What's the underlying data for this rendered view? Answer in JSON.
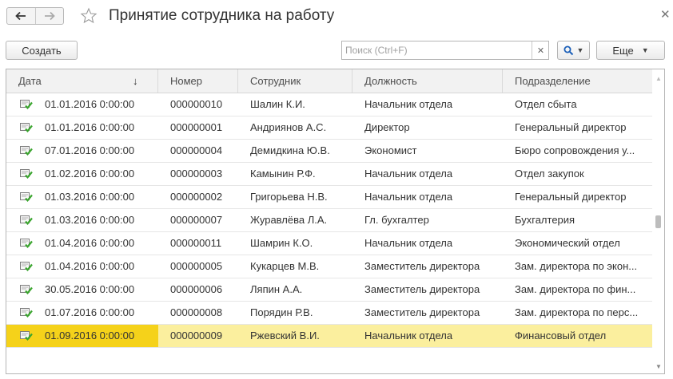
{
  "window": {
    "title": "Принятие сотрудника на работу"
  },
  "toolbar": {
    "create_label": "Создать",
    "search_placeholder": "Поиск (Ctrl+F)",
    "search_value": "",
    "more_label": "Еще"
  },
  "table": {
    "columns": [
      "Дата",
      "Номер",
      "Сотрудник",
      "Должность",
      "Подразделение"
    ],
    "sort_column": "Дата",
    "sort_direction": "descending",
    "selected_row_index": 10,
    "rows": [
      [
        "01.01.2016 0:00:00",
        "000000010",
        "Шалин К.И.",
        "Начальник отдела",
        "Отдел сбыта"
      ],
      [
        "01.01.2016 0:00:00",
        "000000001",
        "Андриянов А.С.",
        "Директор",
        "Генеральный директор"
      ],
      [
        "07.01.2016 0:00:00",
        "000000004",
        "Демидкина Ю.В.",
        "Экономист",
        "Бюро сопровождения у..."
      ],
      [
        "01.02.2016 0:00:00",
        "000000003",
        "Камынин Р.Ф.",
        "Начальник отдела",
        "Отдел закупок"
      ],
      [
        "01.03.2016 0:00:00",
        "000000002",
        "Григорьева Н.В.",
        "Начальник отдела",
        "Генеральный директор"
      ],
      [
        "01.03.2016 0:00:00",
        "000000007",
        "Журавлёва Л.А.",
        "Гл. бухгалтер",
        "Бухгалтерия"
      ],
      [
        "01.04.2016 0:00:00",
        "000000011",
        "Шамрин К.О.",
        "Начальник отдела",
        "Экономический отдел"
      ],
      [
        "01.04.2016 0:00:00",
        "000000005",
        "Кукарцев М.В.",
        "Заместитель директора",
        "Зам. директора по экон..."
      ],
      [
        "30.05.2016 0:00:00",
        "000000006",
        "Ляпин А.А.",
        "Заместитель директора",
        "Зам. директора по фин..."
      ],
      [
        "01.07.2016 0:00:00",
        "000000008",
        "Порядин Р.В.",
        "Заместитель директора",
        "Зам. директора по перс..."
      ],
      [
        "01.09.2016 0:00:00",
        "000000009",
        "Ржевский В.И.",
        "Начальник отдела",
        "Финансовый отдел"
      ]
    ]
  },
  "icons": {
    "back": "arrow-left-icon",
    "forward": "arrow-right-icon",
    "favorite": "star-icon",
    "close": "close-icon",
    "search": "search-icon",
    "row": "posted-document-icon"
  },
  "colors": {
    "selected_row": "#fbef9e",
    "selected_cell": "#f5d21a",
    "check_green": "#3aa52e"
  }
}
